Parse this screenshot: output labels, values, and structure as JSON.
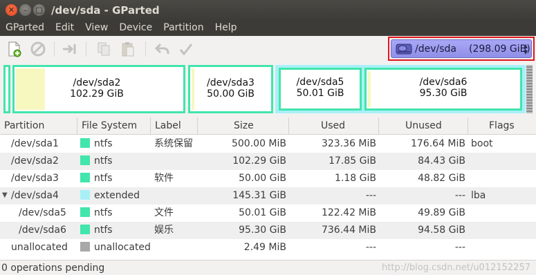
{
  "window": {
    "title": "/dev/sda - GParted",
    "buttons": {
      "close": "✕",
      "minimize": "–",
      "maximize": "□"
    }
  },
  "menubar": [
    "GParted",
    "Edit",
    "View",
    "Device",
    "Partition",
    "Help"
  ],
  "toolbar": {
    "buttons": [
      {
        "name": "new-partition-icon",
        "enabled": true
      },
      {
        "name": "delete-partition-icon",
        "enabled": false
      },
      {
        "name": "resize-move-icon",
        "enabled": false
      },
      {
        "name": "copy-icon",
        "enabled": false
      },
      {
        "name": "paste-icon",
        "enabled": false
      },
      {
        "name": "undo-icon",
        "enabled": false
      },
      {
        "name": "apply-icon",
        "enabled": false
      }
    ]
  },
  "device": {
    "name": "/dev/sda",
    "size": "(298.09 GiB)",
    "icon": "hard-disk-icon"
  },
  "diskmap": [
    {
      "name": "/dev/sda2",
      "size": "102.29 GiB"
    },
    {
      "name": "/dev/sda3",
      "size": "50.00 GiB"
    },
    {
      "name": "/dev/sda5",
      "size": "50.01 GiB"
    },
    {
      "name": "/dev/sda6",
      "size": "95.30 GiB"
    }
  ],
  "table": {
    "headers": [
      "Partition",
      "File System",
      "Label",
      "Size",
      "Used",
      "Unused",
      "Flags"
    ],
    "rows": [
      {
        "partition": "/dev/sda1",
        "fs": "ntfs",
        "label": "系统保留",
        "size": "500.00 MiB",
        "used": "323.36 MiB",
        "unused": "176.64 MiB",
        "flags": "boot"
      },
      {
        "partition": "/dev/sda2",
        "fs": "ntfs",
        "label": "",
        "size": "102.29 GiB",
        "used": "17.85 GiB",
        "unused": "84.43 GiB",
        "flags": ""
      },
      {
        "partition": "/dev/sda3",
        "fs": "ntfs",
        "label": "软件",
        "size": "50.00 GiB",
        "used": "1.18 GiB",
        "unused": "48.82 GiB",
        "flags": ""
      },
      {
        "partition": "/dev/sda4",
        "fs": "extended",
        "label": "",
        "size": "145.31 GiB",
        "used": "---",
        "unused": "---",
        "flags": "lba"
      },
      {
        "partition": "/dev/sda5",
        "fs": "ntfs",
        "label": "文件",
        "size": "50.01 GiB",
        "used": "122.42 MiB",
        "unused": "49.89 GiB",
        "flags": ""
      },
      {
        "partition": "/dev/sda6",
        "fs": "ntfs",
        "label": "娱乐",
        "size": "95.30 GiB",
        "used": "736.44 MiB",
        "unused": "94.58 GiB",
        "flags": ""
      },
      {
        "partition": "unallocated",
        "fs": "unallocated",
        "label": "",
        "size": "2.49 MiB",
        "used": "---",
        "unused": "---",
        "flags": ""
      }
    ]
  },
  "colors": {
    "ntfs": "#42e5ac",
    "extended": "#a8f0f8",
    "unallocated": "#a8a8a8",
    "used_space": "#f7f7c0",
    "highlight": "#e0161c"
  },
  "status": {
    "text": "0 operations pending",
    "watermark": "http://blog.csdn.net/u012152257"
  }
}
